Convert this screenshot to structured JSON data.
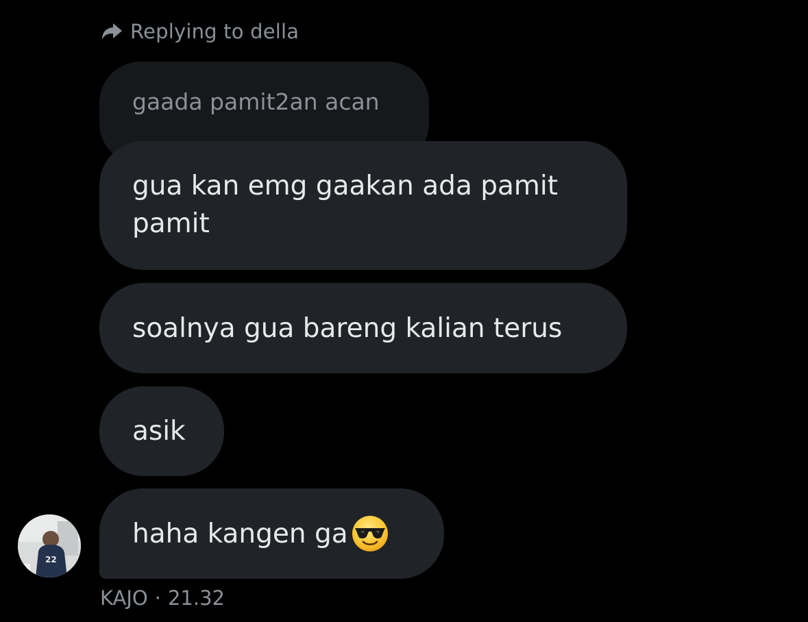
{
  "reply_header": {
    "icon": "reply-arrow-icon",
    "text": "Replying to della"
  },
  "quoted_message": {
    "text": "gaada pamit2an acan"
  },
  "messages": [
    {
      "text": "gua kan emg gaakan ada pamit pamit"
    },
    {
      "text": "soalnya gua bareng kalian terus"
    },
    {
      "text": "asik"
    },
    {
      "text": "haha kangen ga",
      "emoji": "sunglasses-emoji"
    }
  ],
  "sender": {
    "avatar_icon": "avatar-photo",
    "name": "KAJO",
    "separator": "·",
    "time": "21.32"
  },
  "colors": {
    "background": "#000000",
    "bubble": "#202327",
    "quoted_bubble": "#16181c",
    "text": "#e7e9ea",
    "muted_text": "#8b9196"
  }
}
